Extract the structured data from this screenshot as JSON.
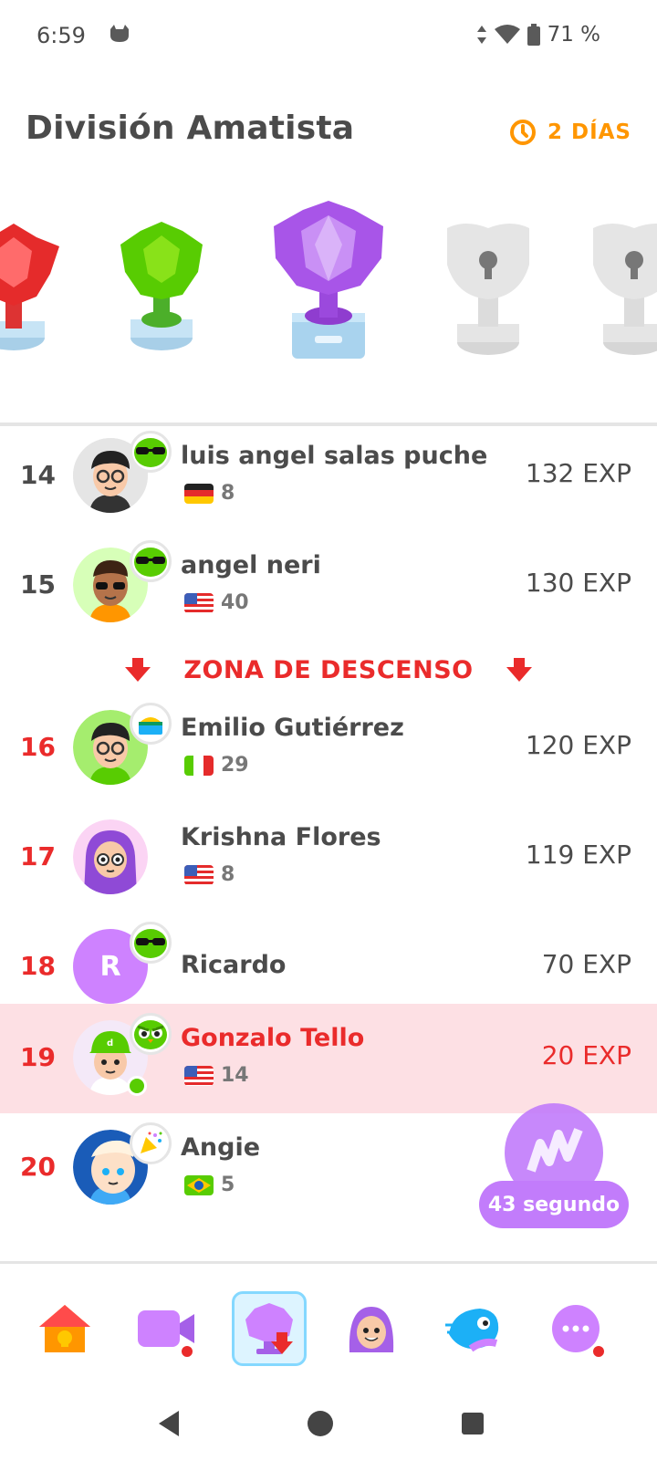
{
  "status_bar": {
    "time": "6:59",
    "battery": "71 %"
  },
  "header": {
    "title": "División Amatista",
    "timer_label": "2 DÍAS"
  },
  "trophies": [
    "ruby",
    "emerald",
    "amethyst",
    "locked",
    "locked"
  ],
  "leaderboard": [
    {
      "rank": "14",
      "name": "luis angel salas puche",
      "country": "germany",
      "streak": "8",
      "exp": "132 EXP",
      "badge": "sunglasses-owl",
      "zone": "normal"
    },
    {
      "rank": "15",
      "name": "angel neri",
      "country": "usa",
      "streak": "40",
      "exp": "130 EXP",
      "badge": "sunglasses-owl",
      "zone": "normal"
    },
    {
      "rank": "16",
      "name": "Emilio Gutiérrez",
      "country": "italy",
      "streak": "29",
      "exp": "120 EXP",
      "badge": "treasure-chest",
      "zone": "demotion"
    },
    {
      "rank": "17",
      "name": "Krishna Flores",
      "country": "usa",
      "streak": "8",
      "exp": "119 EXP",
      "badge": "",
      "zone": "demotion"
    },
    {
      "rank": "18",
      "name": "Ricardo",
      "initial": "R",
      "country": "",
      "streak": "",
      "exp": "70 EXP",
      "badge": "sunglasses-owl",
      "zone": "demotion"
    },
    {
      "rank": "19",
      "name": "Gonzalo Tello",
      "country": "usa",
      "streak": "14",
      "exp": "20 EXP",
      "badge": "angry-owl",
      "zone": "demotion",
      "is_me": true
    },
    {
      "rank": "20",
      "name": "Angie",
      "country": "brazil",
      "streak": "5",
      "exp": "",
      "badge": "party-popper",
      "zone": "demotion"
    }
  ],
  "demotion_zone_label": "ZONA DE DESCENSO",
  "boost": {
    "label": "43 segundo"
  },
  "tabs": [
    {
      "name": "learn",
      "icon": "home-icon"
    },
    {
      "name": "video-call",
      "icon": "video-icon",
      "notification": true
    },
    {
      "name": "leagues",
      "icon": "leagues-icon",
      "active": true
    },
    {
      "name": "profile",
      "icon": "profile-icon"
    },
    {
      "name": "duo",
      "icon": "duo-icon"
    },
    {
      "name": "more",
      "icon": "more-icon",
      "notification": true
    }
  ],
  "colors": {
    "accent_red": "#ea2b2b",
    "orange": "#ff9600",
    "purple": "#c27cfb",
    "highlight": "#fde0e4"
  }
}
